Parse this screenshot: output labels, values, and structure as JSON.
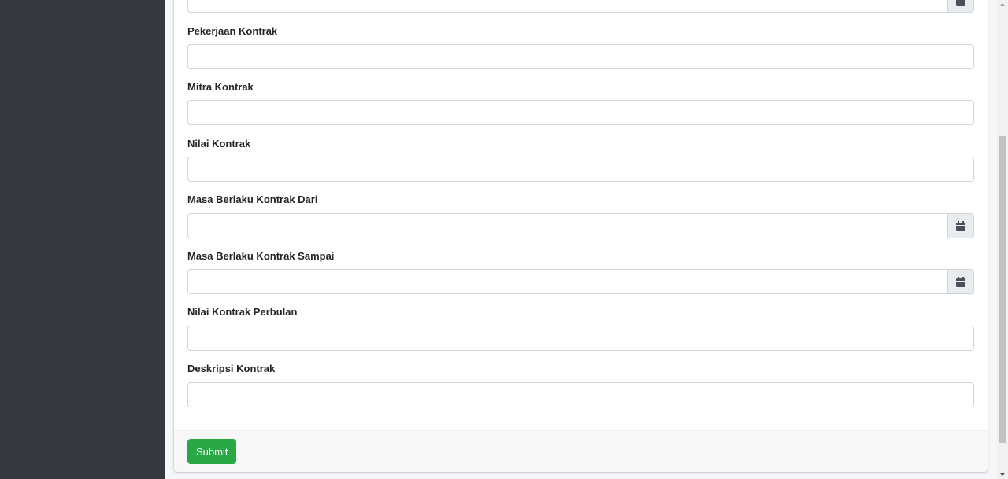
{
  "form": {
    "fields": [
      {
        "label": "Pekerjaan Kontrak",
        "value": "",
        "has_calendar": false
      },
      {
        "label": "Mitra Kontrak",
        "value": "",
        "has_calendar": false
      },
      {
        "label": "Nilai Kontrak",
        "value": "",
        "has_calendar": false
      },
      {
        "label": "Masa Berlaku Kontrak Dari",
        "value": "",
        "has_calendar": true
      },
      {
        "label": "Masa Berlaku Kontrak Sampai",
        "value": "",
        "has_calendar": true
      },
      {
        "label": "Nilai Kontrak Perbulan",
        "value": "",
        "has_calendar": false
      },
      {
        "label": "Deskripsi Kontrak",
        "value": "",
        "has_calendar": false
      }
    ],
    "submit_label": "Submit"
  },
  "icons": {
    "calendar": "calendar-icon"
  },
  "colors": {
    "sidebar": "#343a40",
    "submit": "#28a745",
    "addon": "#e9ecef"
  }
}
